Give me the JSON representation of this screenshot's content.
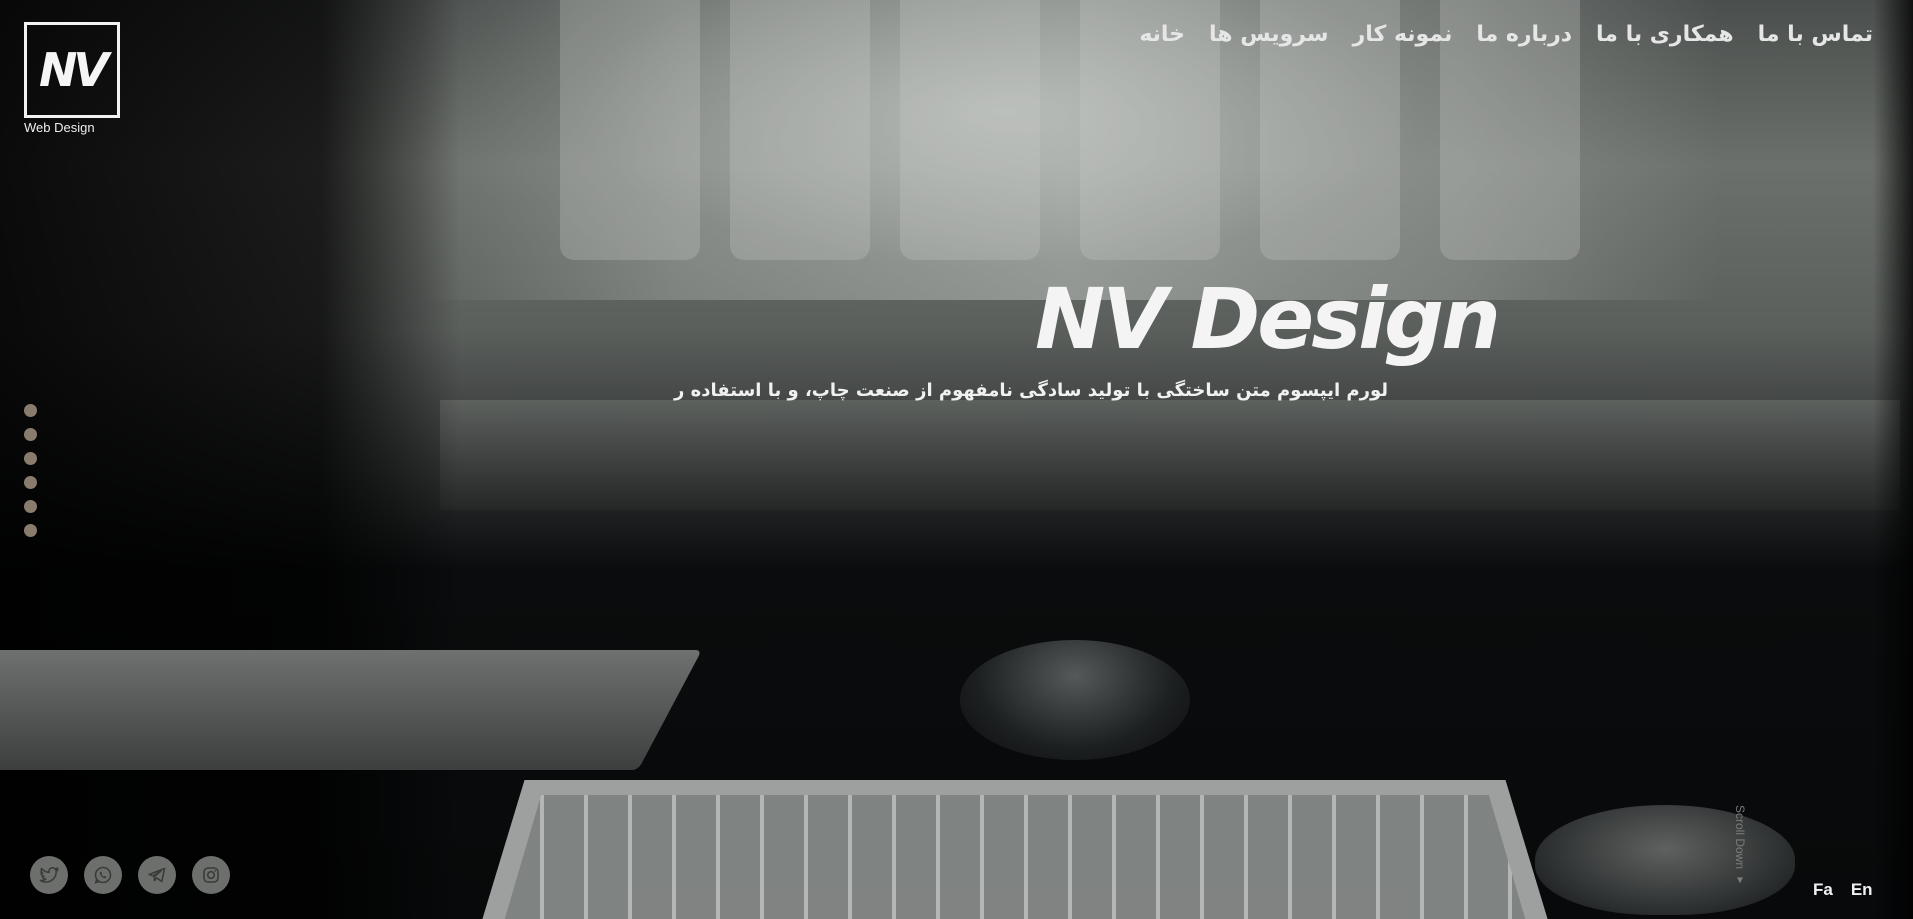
{
  "logo": {
    "mark": "NV",
    "subtitle": "Web Design"
  },
  "nav": {
    "items": [
      {
        "label": "خانه"
      },
      {
        "label": "سرویس ها"
      },
      {
        "label": "نمونه کار"
      },
      {
        "label": "درباره ما"
      },
      {
        "label": "همکاری با ما"
      },
      {
        "label": "تماس با ما"
      }
    ]
  },
  "hero": {
    "title": "NV Design",
    "subtitle": "لورم ایپسوم متن ساختگی با تولید سادگی نامفهوم از صنعت چاپ، و با استفاده ر"
  },
  "side_dots": {
    "count": 6,
    "color": "#8a7c6d"
  },
  "socials": {
    "icons": [
      "twitter-icon",
      "whatsapp-icon",
      "telegram-icon",
      "instagram-icon"
    ],
    "color": "#6d6f6d"
  },
  "scroll": {
    "label": "Scroll Down ▾"
  },
  "language": {
    "fa": "Fa",
    "en": "En"
  }
}
